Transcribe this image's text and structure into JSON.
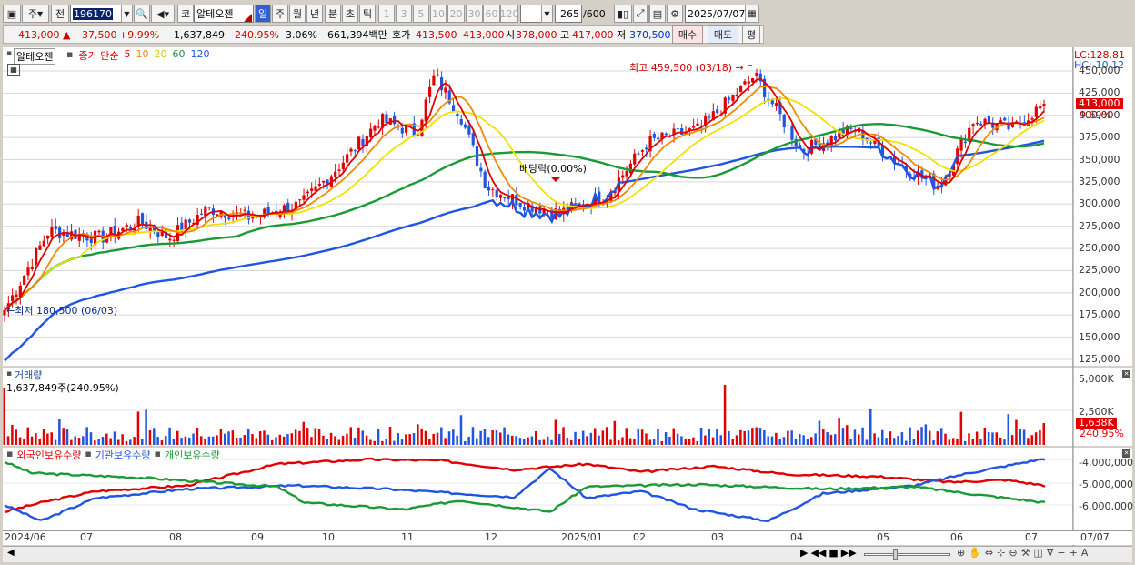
{
  "toolbar": {
    "market": "주",
    "prev": "전",
    "code": "196170",
    "name_prefix": "코",
    "name": "알테오젠",
    "periods": [
      "일",
      "주",
      "월",
      "년",
      "분",
      "초",
      "틱"
    ],
    "active_period": "일",
    "intervals": [
      "1",
      "3",
      "5",
      "10",
      "20",
      "30",
      "60",
      "120"
    ],
    "count": "265",
    "count_total": "/600",
    "date": "2025/07/07"
  },
  "quote": {
    "price": "413,000",
    "change_arrow": "▲",
    "change": "37,500",
    "change_pct": "+9.99%",
    "volume": "1,637,849",
    "volume_ratio": "240.95%",
    "turnover": "3.06%",
    "amount": "661,394백만",
    "ask_label": "호가",
    "ask1": "413,500",
    "ask2": "413,000",
    "open_label": "시",
    "open": "378,000",
    "high_label": "고",
    "high": "417,000",
    "low_label": "저",
    "low": "370,500",
    "buy": "매수",
    "sell": "매도",
    "eval": "평"
  },
  "price_panel": {
    "stock": "알테오젠",
    "ma_label": "종가 단순",
    "ma_periods": [
      "5",
      "10",
      "20",
      "60",
      "120"
    ],
    "ma_colors": [
      "#e00000",
      "#f08a00",
      "#f2e000",
      "#1a9a36",
      "#1f55e0"
    ],
    "max_label": "최고 459,500 (03/18) →",
    "min_label": "←최저 180,500 (06/03)",
    "div_label": "배당락(0.00%)",
    "lc": "LC:128.81",
    "hc": "HC:-10.12",
    "last_tag": "413,000",
    "last_pct": "9.69%",
    "yticks": [
      "450,000",
      "425,000",
      "400,000",
      "375,000",
      "350,000",
      "325,000",
      "300,000",
      "275,000",
      "250,000",
      "225,000",
      "200,000",
      "175,000",
      "150,000",
      "125,000"
    ]
  },
  "volume_panel": {
    "title": "거래량",
    "value": "1,637,849주(240.95%)",
    "yticks": [
      "5,000K",
      "2,500K"
    ],
    "tag": "1,638K",
    "tag_pct": "240.95%"
  },
  "holder_panel": {
    "series": [
      "외국인보유수량",
      "기관보유수량",
      "개인보유수량"
    ],
    "colors": [
      "#e00000",
      "#1f55e0",
      "#1a9a36"
    ],
    "yticks": [
      "-4,000,000",
      "-5,000,000",
      "-6,000,000"
    ]
  },
  "xaxis": {
    "labels": [
      "2024/06",
      "07",
      "08",
      "09",
      "10",
      "11",
      "12",
      "2025/01",
      "02",
      "03",
      "04",
      "05",
      "06",
      "07"
    ],
    "right_label": "07/07"
  },
  "chart_data": {
    "type": "candlestick",
    "ylim": [
      120000,
      470000
    ],
    "close_approx": [
      [
        "2024/06/03",
        180500
      ],
      [
        "2024/06/20",
        270000
      ],
      [
        "2024/07/10",
        262000
      ],
      [
        "2024/07/25",
        280000
      ],
      [
        "2024/08/05",
        262000
      ],
      [
        "2024/08/20",
        295000
      ],
      [
        "2024/09/05",
        285000
      ],
      [
        "2024/09/25",
        300000
      ],
      [
        "2024/10/10",
        345000
      ],
      [
        "2024/10/25",
        395000
      ],
      [
        "2024/11/08",
        380000
      ],
      [
        "2024/11/15",
        445000
      ],
      [
        "2024/11/25",
        400000
      ],
      [
        "2024/12/05",
        320000
      ],
      [
        "2024/12/20",
        300000
      ],
      [
        "2025/01/02",
        290000
      ],
      [
        "2025/01/20",
        310000
      ],
      [
        "2025/02/05",
        370000
      ],
      [
        "2025/02/25",
        385000
      ],
      [
        "2025/03/18",
        445000
      ],
      [
        "2025/04/05",
        360000
      ],
      [
        "2025/04/25",
        385000
      ],
      [
        "2025/05/15",
        340000
      ],
      [
        "2025/05/28",
        320000
      ],
      [
        "2025/06/10",
        395000
      ],
      [
        "2025/06/25",
        385000
      ],
      [
        "2025/07/07",
        413000
      ]
    ]
  }
}
